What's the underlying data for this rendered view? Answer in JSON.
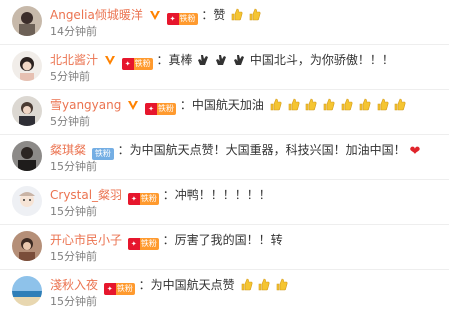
{
  "comments": [
    {
      "name": "Angelia倾城暖洋",
      "text": "：赞",
      "time": "14分钟前",
      "has_v": true,
      "badge": "铁粉",
      "emoji_count": 2,
      "emoji": "thumbs-up",
      "heart": false
    },
    {
      "name": "北北酱汁",
      "text": "：真棒",
      "text2": "中国北斗，为你骄傲！！！",
      "time": "5分钟前",
      "has_v": true,
      "badge": "铁粉",
      "emoji_count": 3,
      "emoji": "clap",
      "heart": false
    },
    {
      "name": "雪yangyang",
      "text": "：中国航天加油",
      "time": "5分钟前",
      "has_v": true,
      "badge": "铁粉",
      "emoji_count": 8,
      "emoji": "thumbs-up",
      "heart": false
    },
    {
      "name": "粲琪粲",
      "text": "：为中国航天点赞！大国重器，科技兴国！加油中国！",
      "time": "15分钟前",
      "has_v": false,
      "badge": "铁粉",
      "badge_style": "blue",
      "emoji_count": 0,
      "heart": true
    },
    {
      "name": "Crystal_粲羽",
      "text": "：冲鸭！！！！！！",
      "time": "15分钟前",
      "has_v": false,
      "badge": "铁粉",
      "emoji_count": 0,
      "heart": false
    },
    {
      "name": "开心市民小子",
      "text": "：厉害了我的国！！转",
      "time": "15分钟前",
      "has_v": false,
      "badge": "铁粉",
      "emoji_count": 0,
      "heart": false
    },
    {
      "name": "淺秋入夜",
      "text": "：为中国航天点赞",
      "time": "15分钟前",
      "has_v": false,
      "badge": "铁粉",
      "emoji_count": 3,
      "emoji": "thumbs-up",
      "heart": false
    }
  ],
  "colors": {
    "name": "#eb7350",
    "time": "#808080",
    "divider": "#eeeeee",
    "badge": "#ff9a2e",
    "emoji": "#f5c531"
  }
}
